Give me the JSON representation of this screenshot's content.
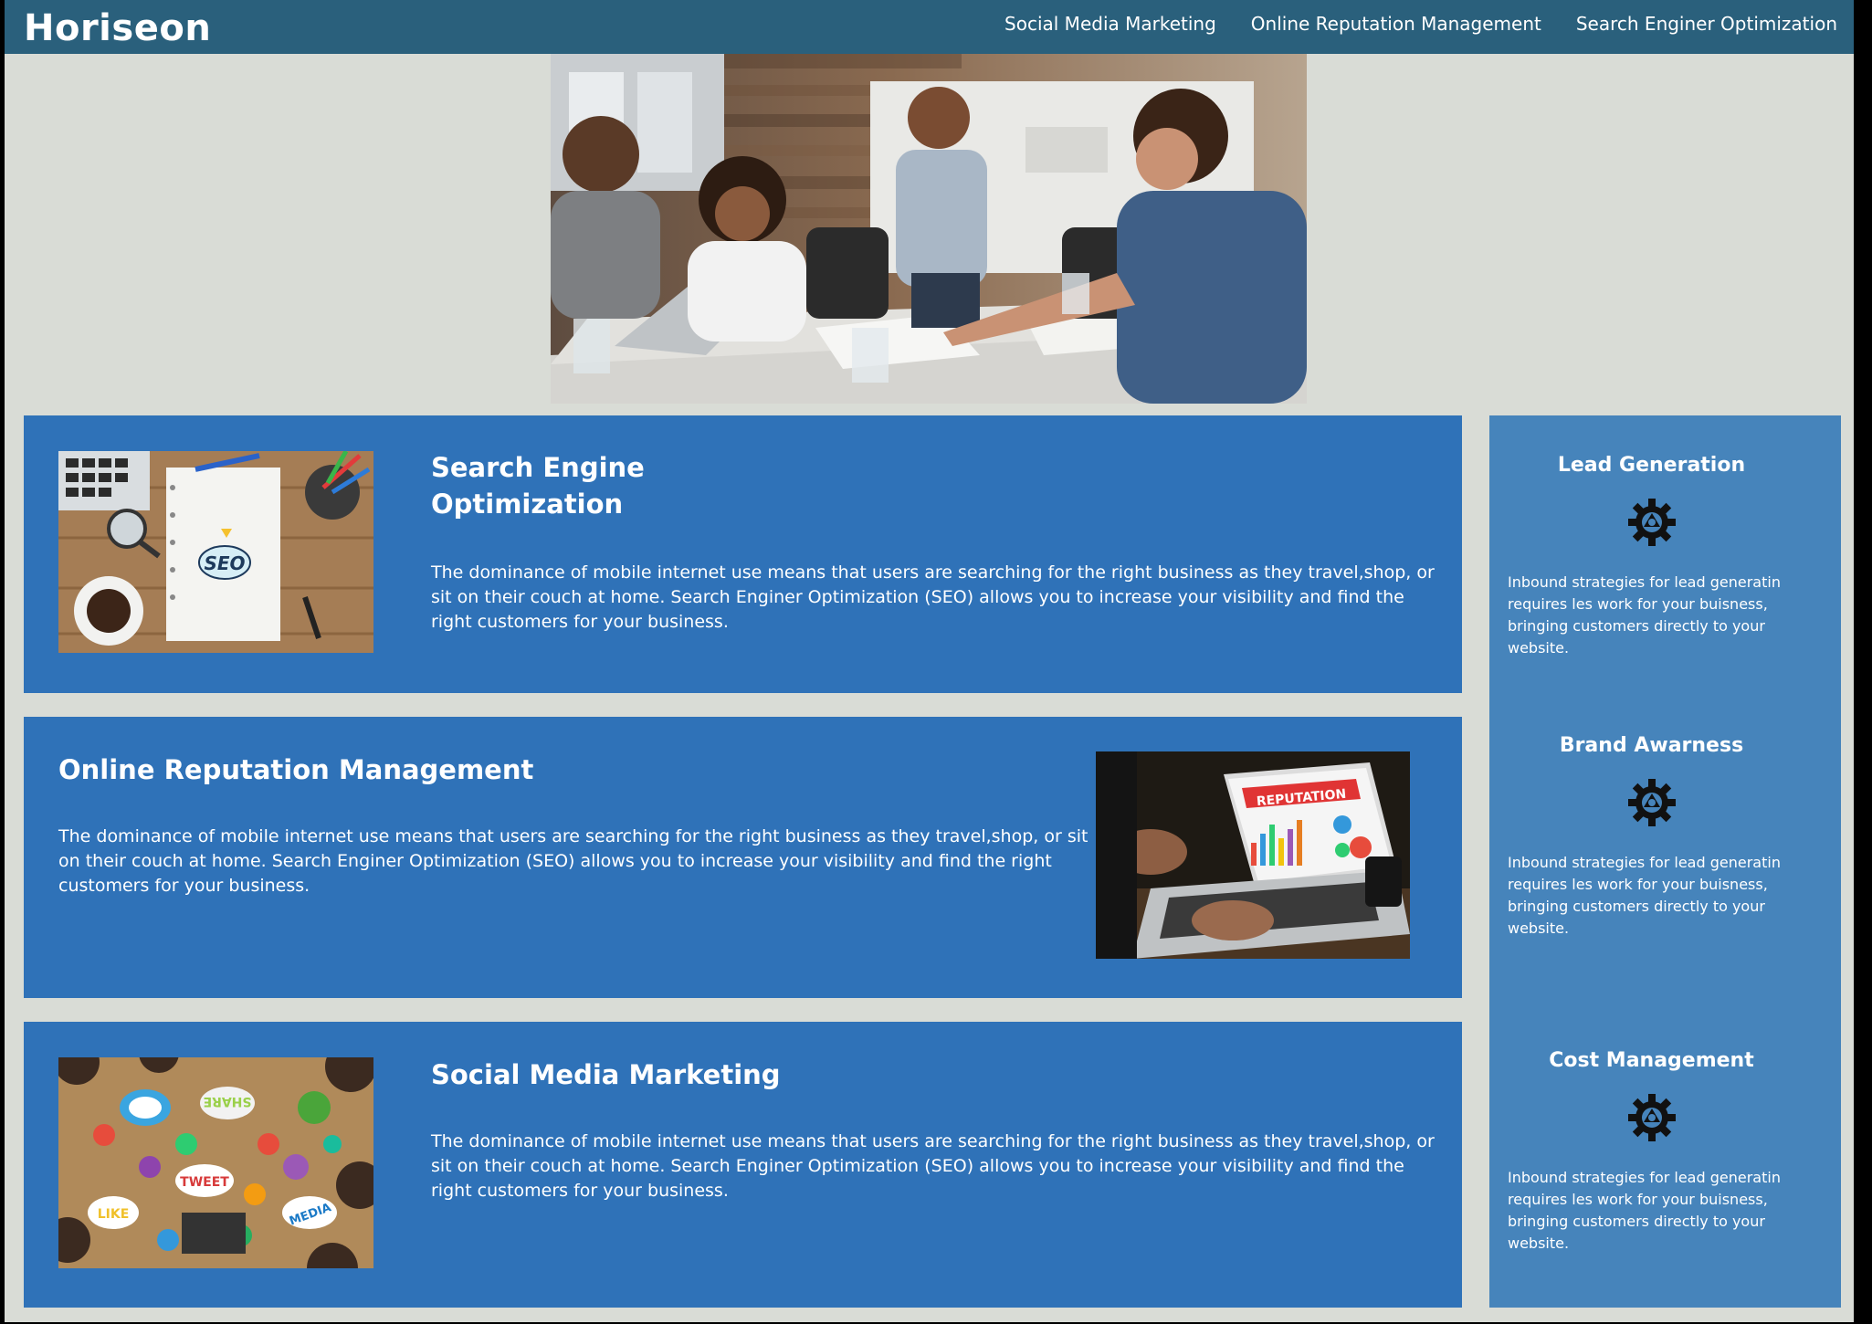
{
  "header": {
    "logo": "Horiseon",
    "nav": [
      {
        "label": "Social Media Marketing"
      },
      {
        "label": "Online Reputation Management"
      },
      {
        "label": "Search Enginer Optimization"
      }
    ]
  },
  "main": {
    "sections": [
      {
        "title_line1": "Search Engine",
        "title_line2": "Optimization",
        "text": "The dominance of mobile internet use means that users are searching for the right business as they travel,shop, or sit on their couch at home. Search Enginer Optimization (SEO) allows you to increase your visibility and find the right customers for your business.",
        "image_label": "SEO"
      },
      {
        "title": "Online Reputation Management",
        "text": "The dominance of mobile internet use means that users are searching for the right business as they travel,shop, or sit on their couch at home. Search Enginer Optimization (SEO) allows you to increase your visibility and find the right customers for your business.",
        "image_label": "REPUTATION"
      },
      {
        "title": "Social Media Marketing",
        "text": "The dominance of mobile internet use means that users are searching for the right business as they travel,shop, or sit on their couch at home. Search Enginer Optimization (SEO) allows you to increase your visibility and find the right customers for your business.",
        "image_labels": [
          "SHARE",
          "TWEET",
          "LIKE",
          "MEDIA"
        ]
      }
    ]
  },
  "sidebar": {
    "items": [
      {
        "title": "Lead Generation",
        "icon": "gear-icon",
        "text": "Inbound strategies for lead generatin requires les work for your buisness, bringing customers directly to your website."
      },
      {
        "title": "Brand Awarness",
        "icon": "gear-icon",
        "text": "Inbound strategies for lead generatin requires les work for your buisness, bringing customers directly to your website."
      },
      {
        "title": "Cost Management",
        "icon": "gear-icon",
        "text": "Inbound strategies for lead generatin requires les work for your buisness, bringing customers directly to your website."
      }
    ]
  },
  "colors": {
    "header_bg": "#2a607c",
    "page_bg": "#d9dcd6",
    "content_bg": "#2f72b8",
    "sidebar_bg": "#4684bb"
  }
}
